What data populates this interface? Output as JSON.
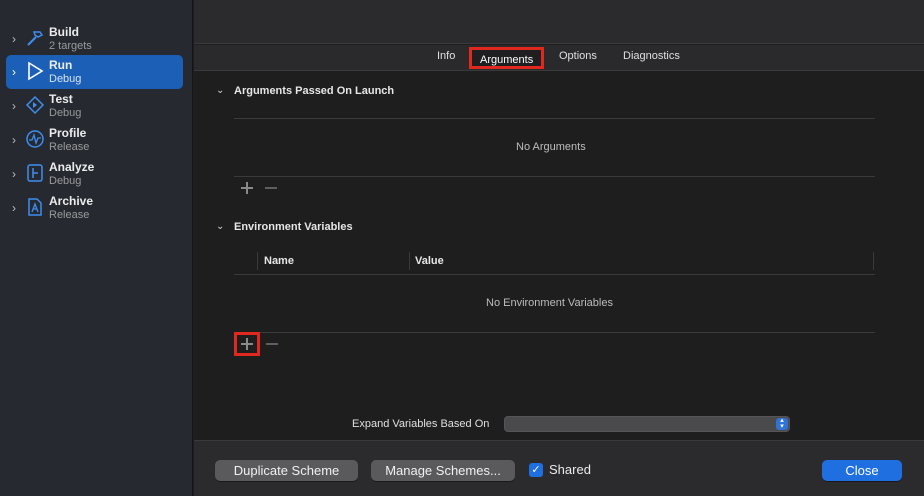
{
  "sidebar": {
    "items": [
      {
        "title": "Build",
        "subtitle": "2 targets",
        "icon": "hammer-icon"
      },
      {
        "title": "Run",
        "subtitle": "Debug",
        "icon": "play-icon"
      },
      {
        "title": "Test",
        "subtitle": "Debug",
        "icon": "diamond-test-icon"
      },
      {
        "title": "Profile",
        "subtitle": "Release",
        "icon": "gauge-icon"
      },
      {
        "title": "Analyze",
        "subtitle": "Debug",
        "icon": "analyze-icon"
      },
      {
        "title": "Archive",
        "subtitle": "Release",
        "icon": "archive-icon"
      }
    ],
    "selected": "Run"
  },
  "tabs": [
    {
      "label": "Info"
    },
    {
      "label": "Arguments",
      "active": true
    },
    {
      "label": "Options"
    },
    {
      "label": "Diagnostics"
    }
  ],
  "arguments_section": {
    "title": "Arguments Passed On Launch",
    "empty_text": "No Arguments"
  },
  "env_section": {
    "title": "Environment Variables",
    "columns": [
      "Name",
      "Value"
    ],
    "empty_text": "No Environment Variables"
  },
  "expand_variables": {
    "label": "Expand Variables Based On",
    "value": ""
  },
  "footer": {
    "duplicate_label": "Duplicate Scheme",
    "manage_label": "Manage Schemes...",
    "shared_label": "Shared",
    "shared_checked": true,
    "close_label": "Close"
  },
  "colors": {
    "accent": "#1f6fe0",
    "highlight": "#e0281e"
  }
}
